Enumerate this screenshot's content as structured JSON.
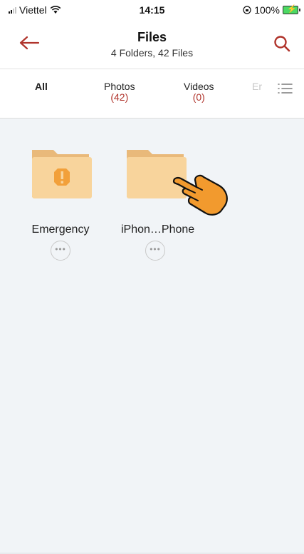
{
  "status_bar": {
    "carrier": "Viettel",
    "time": "14:15",
    "battery": "100%"
  },
  "header": {
    "title": "Files",
    "subtitle": "4 Folders, 42 Files"
  },
  "tabs": [
    {
      "label": "All",
      "count": ""
    },
    {
      "label": "Photos",
      "count": "(42)"
    },
    {
      "label": "Videos",
      "count": "(0)"
    },
    {
      "label": "Er",
      "count": ""
    }
  ],
  "folders": [
    {
      "name": "Emergency",
      "more": "•••"
    },
    {
      "name": "iPhon…Phone",
      "more": "•••"
    }
  ],
  "colors": {
    "accent": "#b0342c",
    "folder": "#f8d49c",
    "folder_tab": "#e9b97a",
    "warning": "#f2a03a",
    "hand": "#f29a2e"
  }
}
